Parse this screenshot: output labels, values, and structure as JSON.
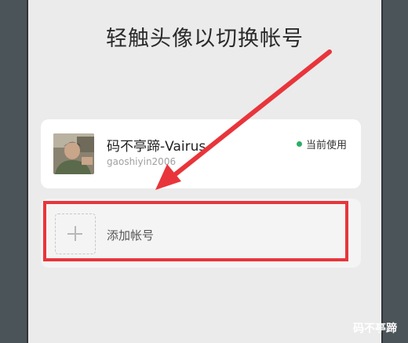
{
  "title": "轻触头像以切换帐号",
  "account": {
    "name": "码不亭蹄-Vairus",
    "id": "gaoshiyin2006",
    "status": "当前使用",
    "status_color": "#2aae67"
  },
  "add_account": {
    "label": "添加帐号",
    "icon": "plus-icon"
  },
  "annotation": {
    "color": "#e8353b"
  },
  "watermark": "码不亭蹄"
}
